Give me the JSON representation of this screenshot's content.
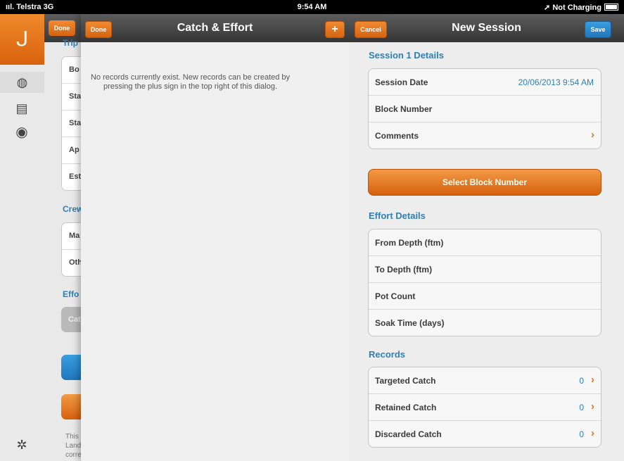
{
  "status_bar": {
    "carrier": "Telstra 3G",
    "time": "9:54 AM",
    "charging": "Not Charging"
  },
  "rail": {
    "logo_glyph": "ᒍ",
    "icons": [
      "globe-icon",
      "document-icon",
      "lifebuoy-icon",
      "settings-gear-icon"
    ]
  },
  "underlying": {
    "done_label": "Done",
    "trip_label": "Trip",
    "trip_cells": [
      "Bo",
      "Sta",
      "Sta",
      "Ap",
      "Est"
    ],
    "crew_label": "Crew",
    "crew_cells": [
      "Ma",
      "Oth"
    ],
    "effort_label": "Effo",
    "effort_button": "Cat",
    "footer_text_1": "This",
    "footer_text_2": "Land",
    "footer_text_3": "corre"
  },
  "catch_panel": {
    "done_label": "Done",
    "title": "Catch & Effort",
    "add_label": "+",
    "empty_message_1": "No records currently exist. New records can be created by",
    "empty_message_2": "pressing the plus sign in the top right of this dialog."
  },
  "session_panel": {
    "cancel_label": "Cancel",
    "title": "New Session",
    "save_label": "Save",
    "details_heading": "Session 1 Details",
    "details_rows": [
      {
        "label": "Session Date",
        "value": "20/06/2013 9:54 AM"
      },
      {
        "label": "Block Number",
        "value": ""
      },
      {
        "label": "Comments",
        "value": ""
      }
    ],
    "select_block_label": "Select Block Number",
    "effort_heading": "Effort Details",
    "effort_rows": [
      "From Depth (ftm)",
      "To Depth (ftm)",
      "Pot Count",
      "Soak Time (days)"
    ],
    "records_heading": "Records",
    "record_rows": [
      {
        "label": "Targeted Catch",
        "count": "0"
      },
      {
        "label": "Retained Catch",
        "count": "0"
      },
      {
        "label": "Discarded Catch",
        "count": "0"
      }
    ]
  },
  "colors": {
    "accent_orange": "#e8731a",
    "link_blue": "#2f7fb5",
    "save_blue": "#1f76bb"
  }
}
